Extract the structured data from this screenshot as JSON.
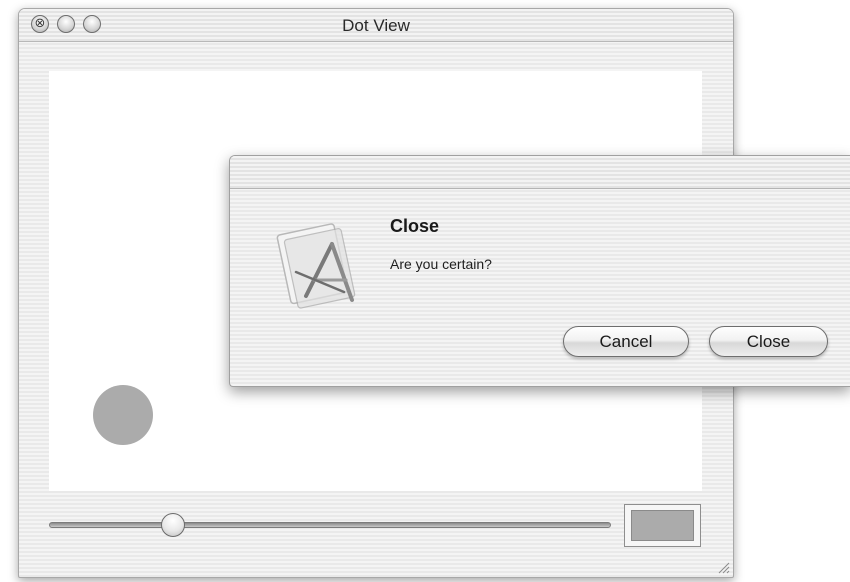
{
  "window": {
    "title": "Dot View",
    "buttons": {
      "close_glyph": "⊗",
      "minimize_glyph": "",
      "zoom_glyph": ""
    }
  },
  "canvas": {
    "background": "#ffffff",
    "dot_color": "#ababab"
  },
  "controls": {
    "slider_value_fraction": 0.22,
    "color_well_color": "#ababab"
  },
  "dialog": {
    "heading": "Close",
    "message": "Are you certain?",
    "icon": "app-icon",
    "buttons": {
      "cancel_label": "Cancel",
      "close_label": "Close"
    }
  }
}
